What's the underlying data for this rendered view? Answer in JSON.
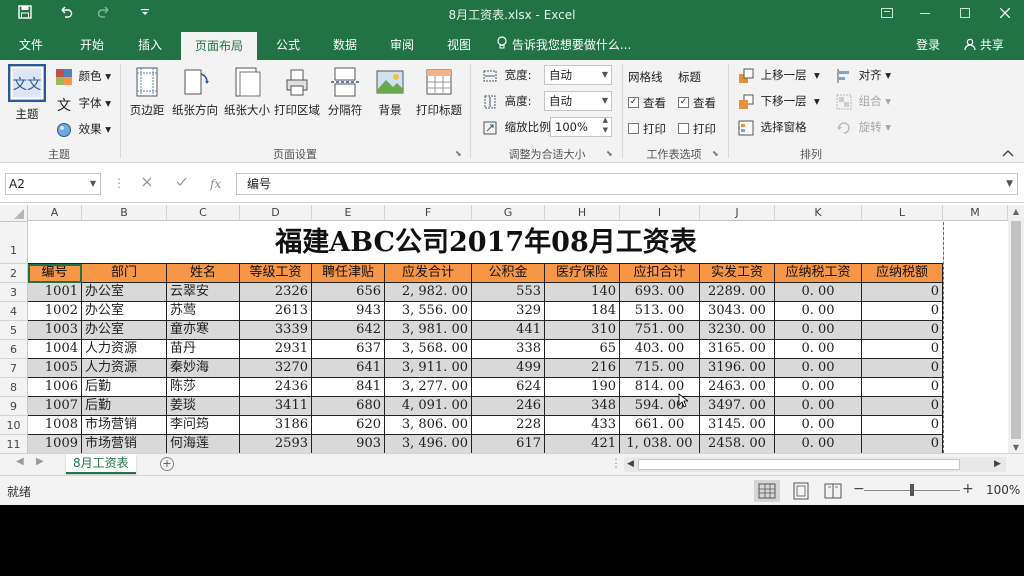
{
  "window": {
    "title": "8月工资表.xlsx - Excel"
  },
  "quick_access": {
    "save_icon": "save-icon",
    "undo_icon": "undo-icon",
    "redo_icon": "redo-icon",
    "customize_icon": "customize-icon"
  },
  "tabs": [
    "文件",
    "开始",
    "插入",
    "页面布局",
    "公式",
    "数据",
    "审阅",
    "视图"
  ],
  "active_tab": "页面布局",
  "tell_me": "告诉我您想要做什么...",
  "account": {
    "login": "登录",
    "share": "共享"
  },
  "ribbon": {
    "theme": {
      "themes": "主题",
      "colors": "颜色",
      "fonts": "字体",
      "effects": "效果",
      "group": "主题"
    },
    "page_setup": {
      "margins": "页边距",
      "orientation": "纸张方向",
      "size": "纸张大小",
      "print_area": "打印区域",
      "breaks": "分隔符",
      "background": "背景",
      "print_titles": "打印标题",
      "group": "页面设置"
    },
    "scale": {
      "width_label": "宽度:",
      "width_value": "自动",
      "height_label": "高度:",
      "height_value": "自动",
      "scale_label": "缩放比例:",
      "scale_value": "100%",
      "group": "调整为合适大小"
    },
    "sheet_options": {
      "gridlines": "网格线",
      "headings": "标题",
      "view": "查看",
      "print": "打印",
      "group": "工作表选项"
    },
    "arrange": {
      "bring_forward": "上移一层",
      "send_backward": "下移一层",
      "selection_pane": "选择窗格",
      "align": "对齐",
      "group_btn": "组合",
      "rotate": "旋转",
      "group": "排列"
    }
  },
  "formula_bar": {
    "name_box": "A2",
    "formula": "编号"
  },
  "columns": [
    "A",
    "B",
    "C",
    "D",
    "E",
    "F",
    "G",
    "H",
    "I",
    "J",
    "K",
    "L",
    "M"
  ],
  "rows": [
    "1",
    "2",
    "3",
    "4",
    "5",
    "6",
    "7",
    "8",
    "9",
    "10",
    "11"
  ],
  "sheet": {
    "title": "福建ABC公司2017年08月工资表",
    "headers": [
      "编号",
      "部门",
      "姓名",
      "等级工资",
      "聘任津贴",
      "应发合计",
      "公积金",
      "医疗保险",
      "应扣合计",
      "实发工资",
      "应纳税工资",
      "应纳税额"
    ],
    "data": [
      [
        "1001",
        "办公室",
        "云翠安",
        "2326",
        "656",
        "2, 982. 00",
        "553",
        "140",
        "693. 00",
        "2289. 00",
        "0. 00",
        "0"
      ],
      [
        "1002",
        "办公室",
        "苏莺",
        "2613",
        "943",
        "3, 556. 00",
        "329",
        "184",
        "513. 00",
        "3043. 00",
        "0. 00",
        "0"
      ],
      [
        "1003",
        "办公室",
        "童亦寒",
        "3339",
        "642",
        "3, 981. 00",
        "441",
        "310",
        "751. 00",
        "3230. 00",
        "0. 00",
        "0"
      ],
      [
        "1004",
        "人力资源",
        "苗丹",
        "2931",
        "637",
        "3, 568. 00",
        "338",
        "65",
        "403. 00",
        "3165. 00",
        "0. 00",
        "0"
      ],
      [
        "1005",
        "人力资源",
        "秦妙海",
        "3270",
        "641",
        "3, 911. 00",
        "499",
        "216",
        "715. 00",
        "3196. 00",
        "0. 00",
        "0"
      ],
      [
        "1006",
        "后勤",
        "陈莎",
        "2436",
        "841",
        "3, 277. 00",
        "624",
        "190",
        "814. 00",
        "2463. 00",
        "0. 00",
        "0"
      ],
      [
        "1007",
        "后勤",
        "姜琰",
        "3411",
        "680",
        "4, 091. 00",
        "246",
        "348",
        "594. 00",
        "3497. 00",
        "0. 00",
        "0"
      ],
      [
        "1008",
        "市场营销",
        "李问筠",
        "3186",
        "620",
        "3, 806. 00",
        "228",
        "433",
        "661. 00",
        "3145. 00",
        "0. 00",
        "0"
      ],
      [
        "1009",
        "市场营销",
        "何海莲",
        "2593",
        "903",
        "3, 496. 00",
        "617",
        "421",
        "1, 038. 00",
        "2458. 00",
        "0. 00",
        "0"
      ]
    ]
  },
  "sheet_tab": "8月工资表",
  "status": {
    "ready": "就绪",
    "zoom": "100%"
  },
  "colors": {
    "brand": "#217346",
    "header_fill": "#f79646",
    "band_fill": "#d9d9d9"
  }
}
